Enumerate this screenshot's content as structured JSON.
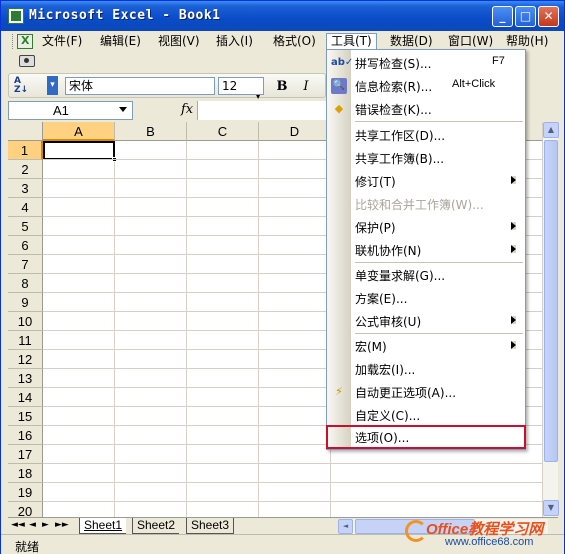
{
  "window": {
    "title": "Microsoft Excel - Book1",
    "min_label": "_",
    "max_label": "□",
    "close_label": "✕"
  },
  "menubar": {
    "items": [
      {
        "label": "文件(F)"
      },
      {
        "label": "编辑(E)"
      },
      {
        "label": "视图(V)"
      },
      {
        "label": "插入(I)"
      },
      {
        "label": "格式(O)"
      },
      {
        "label": "工具(T)"
      },
      {
        "label": "数据(D)"
      },
      {
        "label": "窗口(W)"
      },
      {
        "label": "帮助(H)"
      }
    ],
    "active_index": 5,
    "right_controls": "- 🗗 ×"
  },
  "formatting": {
    "font": "宋体",
    "size": "12",
    "bold": "B",
    "italic": "I"
  },
  "formula_bar": {
    "name_box": "A1",
    "fx": "fx",
    "formula": ""
  },
  "grid": {
    "columns": [
      "A",
      "B",
      "C",
      "D"
    ],
    "rows": [
      "1",
      "2",
      "3",
      "4",
      "5",
      "6",
      "7",
      "8",
      "9",
      "10",
      "11",
      "12",
      "13",
      "14",
      "15",
      "16",
      "17",
      "18",
      "19",
      "20"
    ],
    "selected_cell": "A1"
  },
  "sheets": {
    "tabs": [
      "Sheet1",
      "Sheet2",
      "Sheet3"
    ],
    "active": "Sheet1",
    "nav": [
      "◄◄",
      "◄",
      "►",
      "►►"
    ]
  },
  "status": {
    "text": "就绪"
  },
  "tools_menu": {
    "items": [
      {
        "label": "拼写检查(S)...",
        "shortcut": "F7",
        "icon": "spellcheck-icon"
      },
      {
        "label": "信息检索(R)...",
        "shortcut": "Alt+Click",
        "icon": "research-icon"
      },
      {
        "label": "错误检查(K)...",
        "icon": "error-check-icon"
      },
      {
        "label": "共享工作区(D)..."
      },
      {
        "label": "共享工作簿(B)..."
      },
      {
        "label": "修订(T)",
        "submenu": true
      },
      {
        "label": "比较和合并工作簿(W)...",
        "disabled": true
      },
      {
        "label": "保护(P)",
        "submenu": true
      },
      {
        "label": "联机协作(N)",
        "submenu": true
      },
      {
        "label": "单变量求解(G)..."
      },
      {
        "label": "方案(E)..."
      },
      {
        "label": "公式审核(U)",
        "submenu": true
      },
      {
        "label": "宏(M)",
        "submenu": true
      },
      {
        "label": "加载宏(I)..."
      },
      {
        "label": "自动更正选项(A)...",
        "icon": "autocorrect-icon"
      },
      {
        "label": "自定义(C)..."
      },
      {
        "label": "选项(O)...",
        "highlighted": true
      }
    ]
  },
  "watermark": {
    "line1": "Office教程学习网",
    "line2": "www.office68.com"
  },
  "colors": {
    "title_bar": "#0a4cc8",
    "highlight_border": "#c8102e",
    "selected_header": "#ffd180"
  }
}
